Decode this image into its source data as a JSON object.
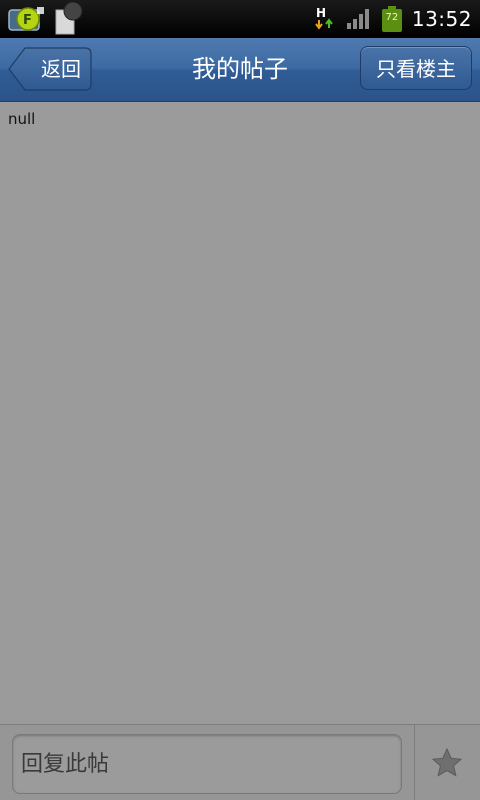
{
  "status_bar": {
    "time": "13:52",
    "battery_level": "72",
    "network_type": "H",
    "icons": [
      "app-notification-icon",
      "file-notification-icon",
      "data-transfer-icon",
      "signal-strength-icon",
      "battery-icon"
    ]
  },
  "header": {
    "title": "我的帖子",
    "back_label": "返回",
    "landlord_only_label": "只看楼主"
  },
  "content": {
    "text": "null"
  },
  "footer": {
    "reply_placeholder": "回复此帖",
    "reply_value": "",
    "favorite_icon": "star-icon"
  },
  "colors": {
    "header_blue": "#3d6aa3",
    "content_gray": "#9b9b9b",
    "battery_green": "#5b8f12",
    "status_bar": "#000000"
  }
}
